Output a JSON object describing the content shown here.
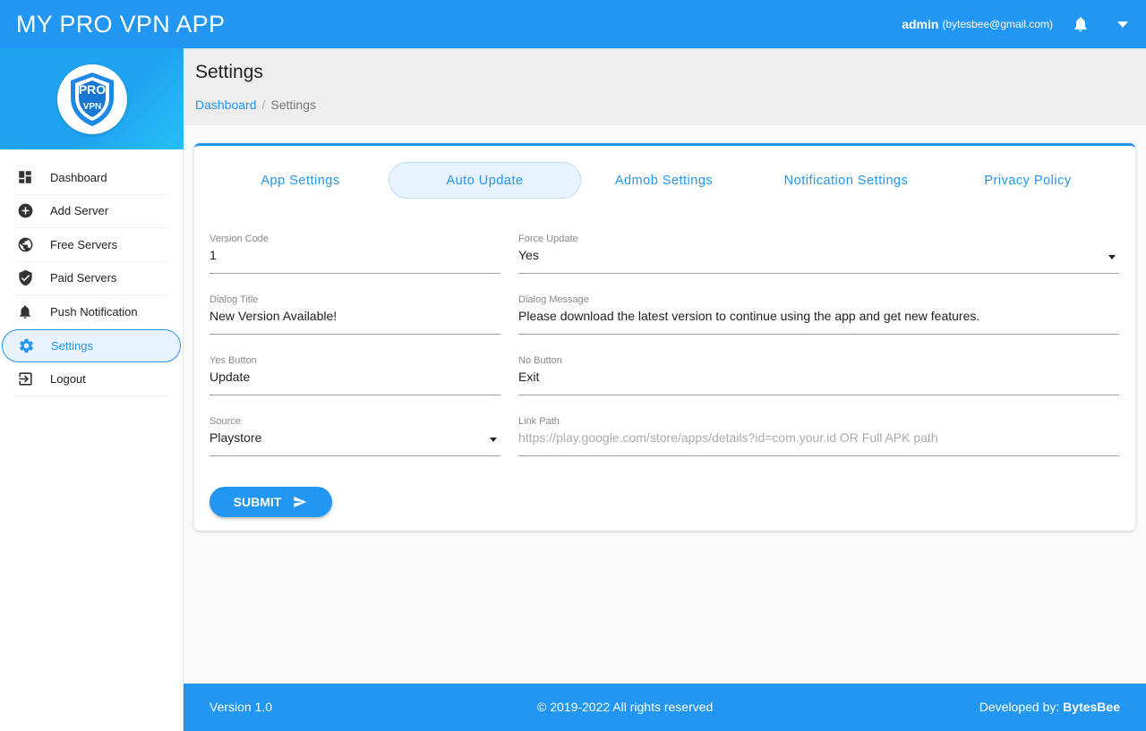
{
  "app": {
    "title": "MY PRO VPN APP"
  },
  "user": {
    "name": "admin",
    "email": "(bytesbee@gmail.com)"
  },
  "logo": {
    "text_top": "PRO",
    "text_bottom": "VPN"
  },
  "sidebar": {
    "items": [
      {
        "label": "Dashboard",
        "icon": "dashboard-icon"
      },
      {
        "label": "Add Server",
        "icon": "add-circle-icon"
      },
      {
        "label": "Free Servers",
        "icon": "globe-icon"
      },
      {
        "label": "Paid Servers",
        "icon": "shield-check-icon"
      },
      {
        "label": "Push Notification",
        "icon": "bell-icon"
      },
      {
        "label": "Settings",
        "icon": "gear-icon",
        "active": true
      },
      {
        "label": "Logout",
        "icon": "logout-icon"
      }
    ]
  },
  "header": {
    "title": "Settings",
    "breadcrumb": {
      "link": "Dashboard",
      "separator": "/",
      "current": "Settings"
    }
  },
  "tabs": [
    {
      "label": "App Settings"
    },
    {
      "label": "Auto Update",
      "active": true
    },
    {
      "label": "Admob Settings"
    },
    {
      "label": "Notification Settings"
    },
    {
      "label": "Privacy Policy"
    }
  ],
  "form": {
    "version_code": {
      "label": "Version Code",
      "value": "1"
    },
    "force_update": {
      "label": "Force Update",
      "value": "Yes"
    },
    "dialog_title": {
      "label": "Dialog Title",
      "value": "New Version Available!"
    },
    "dialog_message": {
      "label": "Dialog Message",
      "value": "Please download the latest version to continue using the app and get new features."
    },
    "yes_button": {
      "label": "Yes Button",
      "value": "Update"
    },
    "no_button": {
      "label": "No Button",
      "value": "Exit"
    },
    "source": {
      "label": "Source",
      "value": "Playstore"
    },
    "link_path": {
      "label": "Link Path",
      "placeholder": "https://play.google.com/store/apps/details?id=com.your.id OR Full APK path"
    },
    "submit_label": "SUBMIT"
  },
  "footer": {
    "version": "Version 1.0",
    "copyright": "© 2019-2022 All rights reserved",
    "developed_label": "Developed by:",
    "developer": "BytesBee"
  },
  "colors": {
    "primary": "#2196f3",
    "active_bg": "#e8f3fe"
  }
}
